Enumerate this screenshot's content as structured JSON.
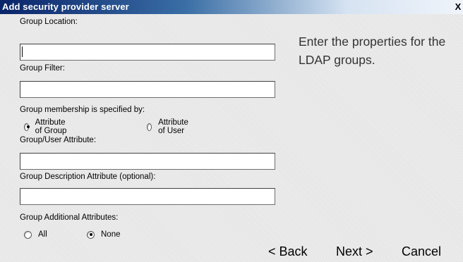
{
  "window": {
    "title": "Add security provider server",
    "close_label": "X"
  },
  "form": {
    "group_location": {
      "label": "Group Location:",
      "value": ""
    },
    "group_filter": {
      "label": "Group Filter:",
      "value": ""
    },
    "membership": {
      "label": "Group membership is specified by:",
      "options": [
        "Attribute of Group",
        "Attribute of User"
      ],
      "selected": "Attribute of Group"
    },
    "group_user_attribute": {
      "label": "Group/User Attribute:",
      "value": ""
    },
    "group_description_attribute": {
      "label": "Group Description Attribute (optional):",
      "value": ""
    },
    "additional_attributes": {
      "label": "Group Additional Attributes:",
      "options": [
        "All",
        "None"
      ],
      "selected": "None"
    }
  },
  "instructions": "Enter the properties for the LDAP groups.",
  "buttons": {
    "back": "< Back",
    "next": "Next >",
    "cancel": "Cancel"
  }
}
